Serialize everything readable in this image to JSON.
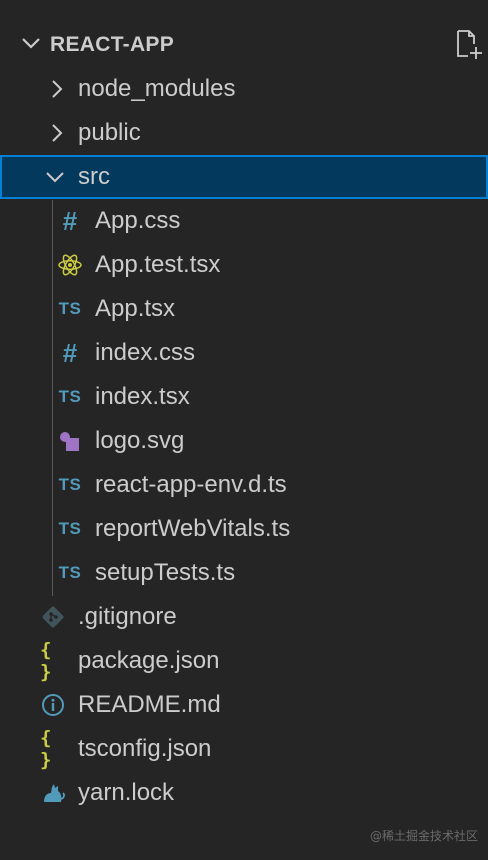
{
  "explorer": {
    "title": "REACT-APP",
    "new_file_icon": "new-file-icon"
  },
  "tree": [
    {
      "label": "node_modules",
      "type": "folder",
      "expanded": false,
      "depth": 0
    },
    {
      "label": "public",
      "type": "folder",
      "expanded": false,
      "depth": 0
    },
    {
      "label": "src",
      "type": "folder",
      "expanded": true,
      "selected": true,
      "depth": 0
    },
    {
      "label": "App.css",
      "type": "file",
      "icon": "css-hash-icon",
      "depth": 1
    },
    {
      "label": "App.test.tsx",
      "type": "file",
      "icon": "react-icon",
      "depth": 1
    },
    {
      "label": "App.tsx",
      "type": "file",
      "icon": "typescript-icon",
      "depth": 1
    },
    {
      "label": "index.css",
      "type": "file",
      "icon": "css-hash-icon",
      "depth": 1
    },
    {
      "label": "index.tsx",
      "type": "file",
      "icon": "typescript-icon",
      "depth": 1
    },
    {
      "label": "logo.svg",
      "type": "file",
      "icon": "svg-shapes-icon",
      "depth": 1
    },
    {
      "label": "react-app-env.d.ts",
      "type": "file",
      "icon": "typescript-icon",
      "depth": 1
    },
    {
      "label": "reportWebVitals.ts",
      "type": "file",
      "icon": "typescript-icon",
      "depth": 1
    },
    {
      "label": "setupTests.ts",
      "type": "file",
      "icon": "typescript-icon",
      "depth": 1
    },
    {
      "label": ".gitignore",
      "type": "file",
      "icon": "git-icon",
      "depth": 0
    },
    {
      "label": "package.json",
      "type": "file",
      "icon": "json-braces-icon",
      "depth": 0
    },
    {
      "label": "README.md",
      "type": "file",
      "icon": "info-icon",
      "depth": 0
    },
    {
      "label": "tsconfig.json",
      "type": "file",
      "icon": "json-braces-icon",
      "depth": 0
    },
    {
      "label": "yarn.lock",
      "type": "file",
      "icon": "yarn-cat-icon",
      "depth": 0
    }
  ],
  "icon_glyphs": {
    "typescript": "TS",
    "css": "#",
    "json": "{ }"
  },
  "watermark": "@稀土掘金技术社区",
  "colors": {
    "background": "#252526",
    "text": "#cccccc",
    "selection_bg": "#04395e",
    "selection_border": "#007fd4",
    "typescript_blue": "#519aba",
    "json_yellow": "#cbcb41",
    "svg_purple": "#a074c4",
    "react_yellow": "#cbcb41",
    "git_gray": "#41535b",
    "yarn_blue": "#519aba"
  }
}
